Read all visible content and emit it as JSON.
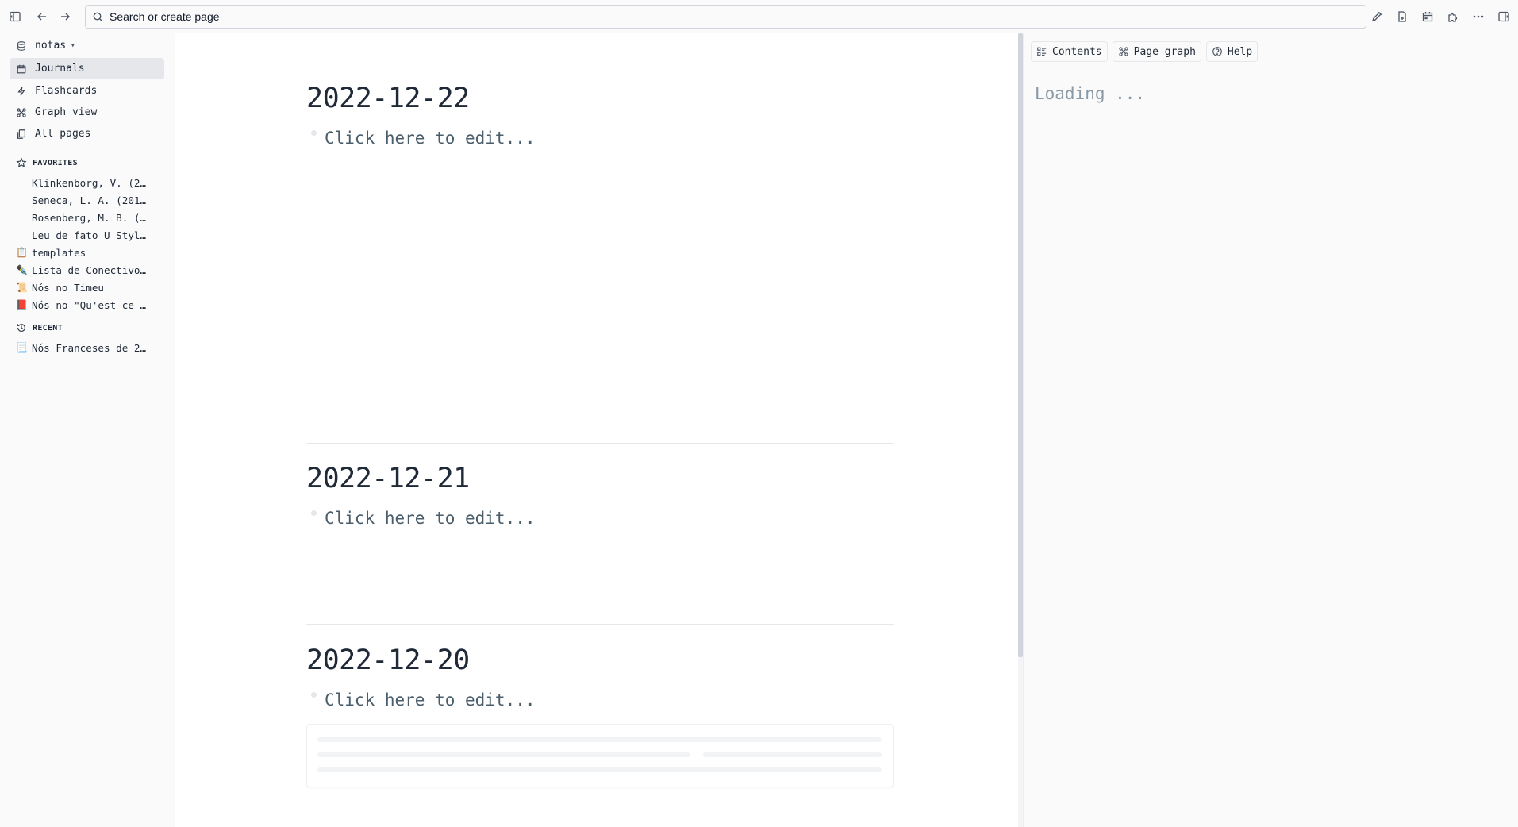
{
  "topbar": {
    "search_placeholder": "Search or create page",
    "left_icons": [
      "toggle-left-sidebar-icon",
      "arrow-left-icon",
      "arrow-right-icon"
    ],
    "right_icons": [
      "pen-icon",
      "new-page-icon",
      "calendar-icon",
      "puzzle-icon",
      "more-icon",
      "toggle-right-sidebar-icon"
    ]
  },
  "sidebar": {
    "graph_name": "notas",
    "nav": [
      {
        "label": "Journals",
        "icon": "calendar-icon",
        "active": true
      },
      {
        "label": "Flashcards",
        "icon": "bolt-icon",
        "active": false
      },
      {
        "label": "Graph view",
        "icon": "graph-icon",
        "active": false
      },
      {
        "label": "All pages",
        "icon": "pages-icon",
        "active": false
      }
    ],
    "favorites_title": "FAVORITES",
    "favorites": [
      {
        "emoji": "",
        "label": "Klinkenborg, V. (2…"
      },
      {
        "emoji": "",
        "label": "Seneca, L. A. (201…"
      },
      {
        "emoji": "",
        "label": "Rosenberg, M. B. (…"
      },
      {
        "emoji": "",
        "label": "Leu de fato U Styl…"
      },
      {
        "emoji": "📋",
        "label": "templates"
      },
      {
        "emoji": "✒️",
        "label": "Lista de Conectivo…"
      },
      {
        "emoji": "📜",
        "label": "Nós no Timeu"
      },
      {
        "emoji": "📕",
        "label": "Nós no \"Qu'est-ce …"
      }
    ],
    "recent_title": "RECENT",
    "recent": [
      {
        "emoji": "📃",
        "label": "Nós Franceses de 2…"
      }
    ]
  },
  "journals": [
    {
      "date": "2022-12-22",
      "placeholder": "Click here to edit..."
    },
    {
      "date": "2022-12-21",
      "placeholder": "Click here to edit..."
    },
    {
      "date": "2022-12-20",
      "placeholder": "Click here to edit..."
    }
  ],
  "rightbar": {
    "tabs": [
      "Contents",
      "Page graph",
      "Help"
    ],
    "loading": "Loading ..."
  }
}
